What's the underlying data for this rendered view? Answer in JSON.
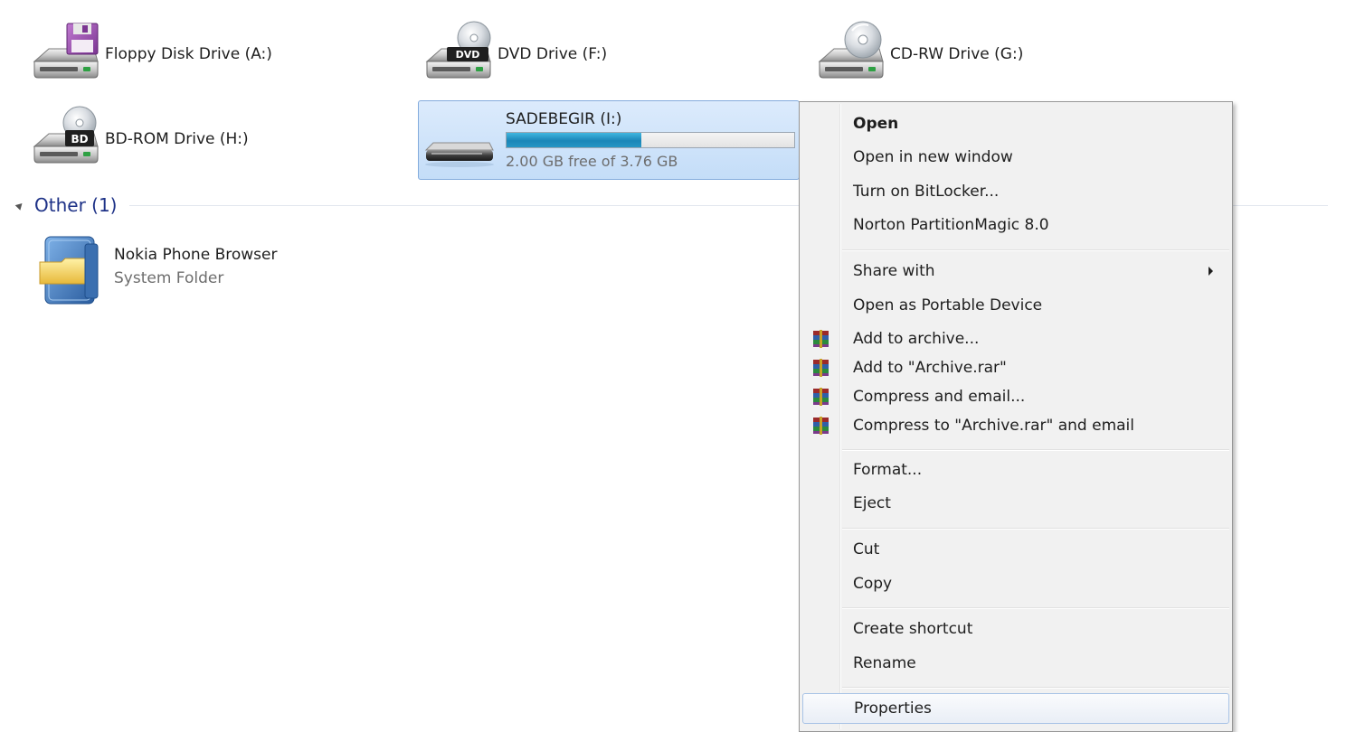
{
  "drives": {
    "floppy": {
      "name": "Floppy Disk Drive (A:)",
      "icon": "floppy-drive-icon"
    },
    "dvd": {
      "name": "DVD Drive (F:)",
      "icon": "dvd-drive-icon",
      "badge": "DVD"
    },
    "cdrw": {
      "name": "CD-RW Drive (G:)",
      "icon": "cd-drive-icon"
    },
    "bdrom": {
      "name": "BD-ROM Drive (H:)",
      "icon": "bd-drive-icon",
      "badge": "BD"
    },
    "usb": {
      "name": "SADEBEGIR (I:)",
      "icon": "usb-drive-icon",
      "free_text": "2.00 GB free of 3.76 GB",
      "used_fraction": 0.468
    }
  },
  "group_other": {
    "label": "Other (1)"
  },
  "nokia": {
    "name": "Nokia Phone Browser",
    "type": "System Folder",
    "icon": "system-folder-icon"
  },
  "context_menu": {
    "items": [
      {
        "label": "Open",
        "bold": true
      },
      {
        "label": "Open in new window"
      },
      {
        "label": "Turn on BitLocker..."
      },
      {
        "label": "Norton PartitionMagic 8.0"
      },
      {
        "label": "Share with",
        "submenu": true
      },
      {
        "label": "Open as Portable Device"
      },
      {
        "label": "Add to archive...",
        "icon": "winrar-icon"
      },
      {
        "label": "Add to \"Archive.rar\"",
        "icon": "winrar-icon"
      },
      {
        "label": "Compress and email...",
        "icon": "winrar-icon"
      },
      {
        "label": "Compress to \"Archive.rar\" and email",
        "icon": "winrar-icon"
      },
      {
        "label": "Format..."
      },
      {
        "label": "Eject"
      },
      {
        "label": "Cut"
      },
      {
        "label": "Copy"
      },
      {
        "label": "Create shortcut"
      },
      {
        "label": "Rename"
      },
      {
        "label": "Properties",
        "hover": true
      }
    ]
  },
  "colors": {
    "selection_bg": "#cfe4fa",
    "capacity_fill": "#2696c4",
    "group_header": "#1e3287"
  }
}
